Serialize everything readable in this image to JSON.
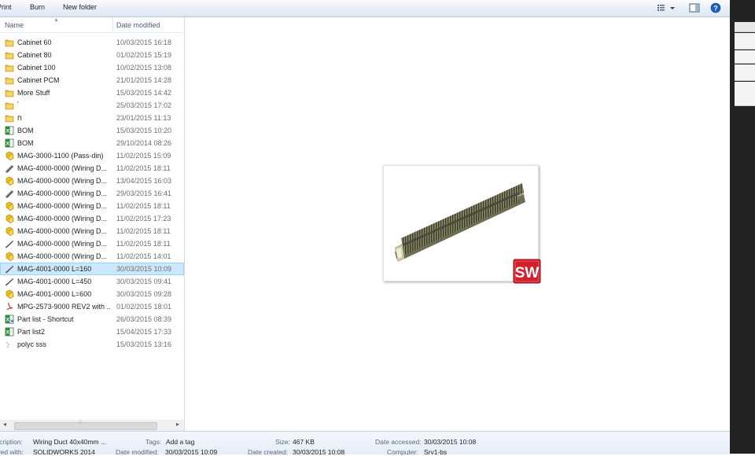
{
  "toolbar": {
    "print_label": "Print",
    "burn_label": "Burn",
    "new_folder_label": "New folder",
    "view_icon": "details-view-icon",
    "preview_icon": "preview-pane-icon",
    "help_icon": "help-icon"
  },
  "columns": {
    "name": "Name",
    "date_modified": "Date modified"
  },
  "files": [
    {
      "name": "Cabinet 60",
      "date": "10/03/2015 16:18",
      "icon": "folder"
    },
    {
      "name": "Cabinet 80",
      "date": "01/02/2015 15:19",
      "icon": "folder"
    },
    {
      "name": "Cabinet 100",
      "date": "10/02/2015 13:08",
      "icon": "folder"
    },
    {
      "name": "Cabinet PCM",
      "date": "21/01/2015 14:28",
      "icon": "folder"
    },
    {
      "name": "More Stuff",
      "date": "15/03/2015 14:42",
      "icon": "folder"
    },
    {
      "name": "ﬞ",
      "date": "25/03/2015 17:02",
      "icon": "folder",
      "masked": true
    },
    {
      "name": "ח",
      "date": "23/01/2015 11:13",
      "icon": "folder",
      "masked": true
    },
    {
      "name": "BOM",
      "date": "15/03/2015 10:20",
      "icon": "excel"
    },
    {
      "name": "BOM",
      "date": "29/10/2014 08:26",
      "icon": "excel"
    },
    {
      "name": "MAG-3000-1100 (Pass-din)",
      "date": "11/02/2015 15:09",
      "icon": "assembly"
    },
    {
      "name": "MAG-4000-0000 (Wiring D...",
      "date": "11/02/2015 18:11",
      "icon": "part"
    },
    {
      "name": "MAG-4000-0000 (Wiring D...",
      "date": "13/04/2015 16:03",
      "icon": "assembly"
    },
    {
      "name": "MAG-4000-0000 (Wiring D...",
      "date": "29/03/2015 16:41",
      "icon": "part"
    },
    {
      "name": "MAG-4000-0000 (Wiring D...",
      "date": "11/02/2015 18:11",
      "icon": "assembly"
    },
    {
      "name": "MAG-4000-0000 (Wiring D...",
      "date": "11/02/2015 17:23",
      "icon": "assembly"
    },
    {
      "name": "MAG-4000-0000 (Wiring D...",
      "date": "11/02/2015 18:11",
      "icon": "assembly"
    },
    {
      "name": "MAG-4000-0000 (Wiring D...",
      "date": "11/02/2015 18:11",
      "icon": "part-line"
    },
    {
      "name": "MAG-4000-0000 (Wiring D...",
      "date": "11/02/2015 14:01",
      "icon": "assembly"
    },
    {
      "name": "MAG-4001-0000 L=160",
      "date": "30/03/2015 10:09",
      "icon": "part-line",
      "selected": true
    },
    {
      "name": "MAG-4001-0000 L=450",
      "date": "30/03/2015 09:41",
      "icon": "part-line"
    },
    {
      "name": "MAG-4001-0000 L=600",
      "date": "30/03/2015 09:28",
      "icon": "assembly"
    },
    {
      "name": "MPG-2573-9000 REV2 with ...",
      "date": "01/02/2015 18:01",
      "icon": "pdf"
    },
    {
      "name": "Part list - Shortcut",
      "date": "26/03/2015 08:39",
      "icon": "excel-shortcut"
    },
    {
      "name": "Part list2",
      "date": "15/04/2015 17:33",
      "icon": "excel"
    },
    {
      "name": "polyc sss",
      "date": "15/03/2015 13:16",
      "icon": "generic"
    }
  ],
  "preview": {
    "badge_text": "SW",
    "badge_color": "#d4202b"
  },
  "details": {
    "description_label": "Description:",
    "description_value": "Wiring Duct 40x40mm ...",
    "saved_with_label": "Saved with:",
    "saved_with_value": "SOLIDWORKS 2014",
    "tags_label": "Tags:",
    "tags_value": "Add a tag",
    "date_modified_label": "Date modified:",
    "date_modified_value": "30/03/2015 10:09",
    "size_label": "Size:",
    "size_value": "467 KB",
    "date_created_label": "Date created:",
    "date_created_value": "30/03/2015 10:08",
    "date_accessed_label": "Date accessed:",
    "date_accessed_value": "30/03/2015 10:08",
    "computer_label": "Computer:",
    "computer_value": "Srv1-bs"
  }
}
